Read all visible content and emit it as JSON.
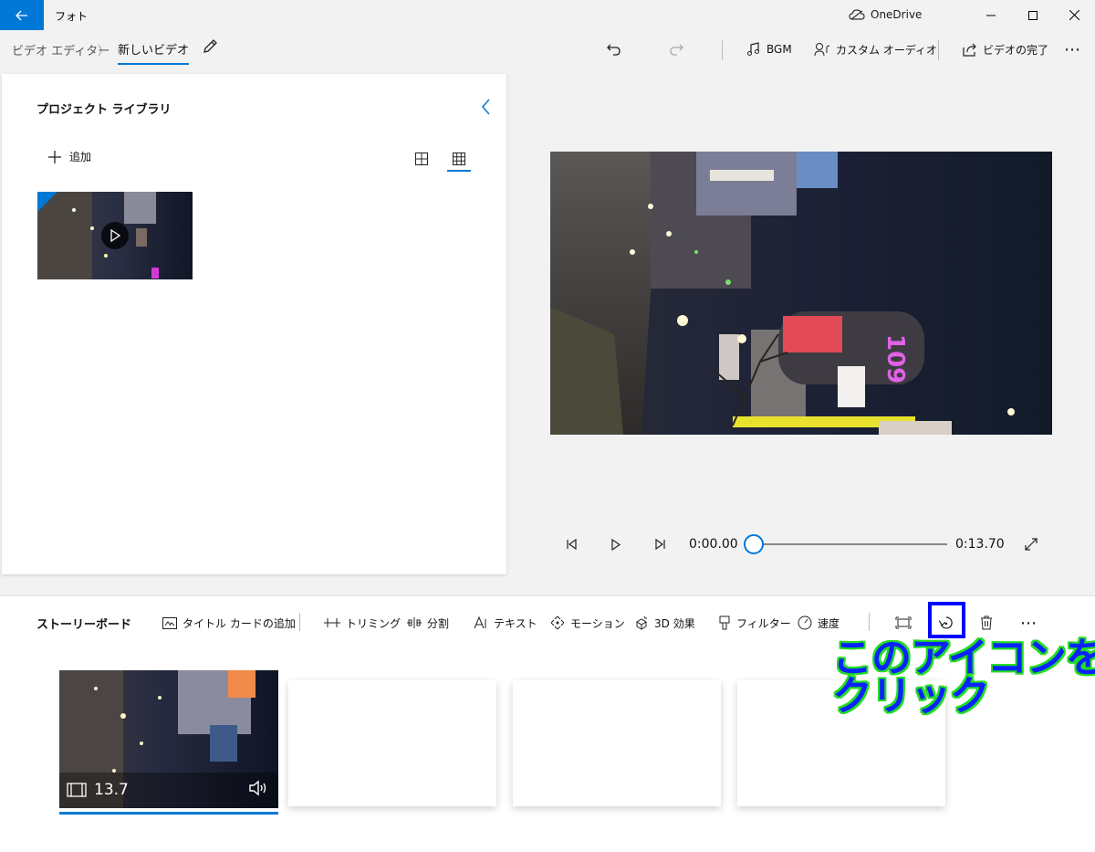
{
  "titlebar": {
    "app_title": "フォト",
    "onedrive_label": "OneDrive"
  },
  "breadcrumb": {
    "parent": "ビデオ エディター",
    "current": "新しいビデオ"
  },
  "commands": {
    "bgm": "BGM",
    "custom_audio": "カスタム オーディオ",
    "finish_video": "ビデオの完了",
    "more": "⋯"
  },
  "library": {
    "title": "プロジェクト ライブラリ",
    "add_label": "追加"
  },
  "playback": {
    "current_time": "0:00.00",
    "total_time": "0:13.70",
    "progress": 0
  },
  "storyboard": {
    "title": "ストーリーボード",
    "title_card": "タイトル カードの追加",
    "trim": "トリミング",
    "split": "分割",
    "text": "テキスト",
    "motion": "モーション",
    "effects_3d": "3D 効果",
    "filters": "フィルター",
    "speed": "速度",
    "more": "⋯",
    "clip_duration": "13.7"
  },
  "annotation": {
    "line1": "このアイコンを",
    "line2": "クリック",
    "highlight_color": "#0000ff",
    "outline_color": "#22dd22"
  },
  "icons": [
    "back-arrow-icon",
    "onedrive-cloud-icon",
    "minimize-icon",
    "maximize-icon",
    "close-icon",
    "pencil-icon",
    "undo-icon",
    "redo-icon",
    "music-note-icon",
    "custom-audio-icon",
    "share-icon",
    "plus-icon",
    "chevron-left-icon",
    "grid-large-icon",
    "grid-small-icon",
    "play-icon",
    "prev-frame-icon",
    "next-frame-icon",
    "fullscreen-icon",
    "title-card-icon",
    "trim-icon",
    "split-icon",
    "text-icon",
    "motion-icon",
    "effects-3d-icon",
    "filter-icon",
    "speed-icon",
    "resize-icon",
    "rotate-icon",
    "trash-icon",
    "film-icon",
    "volume-icon"
  ],
  "colors": {
    "accent": "#0078d7"
  }
}
